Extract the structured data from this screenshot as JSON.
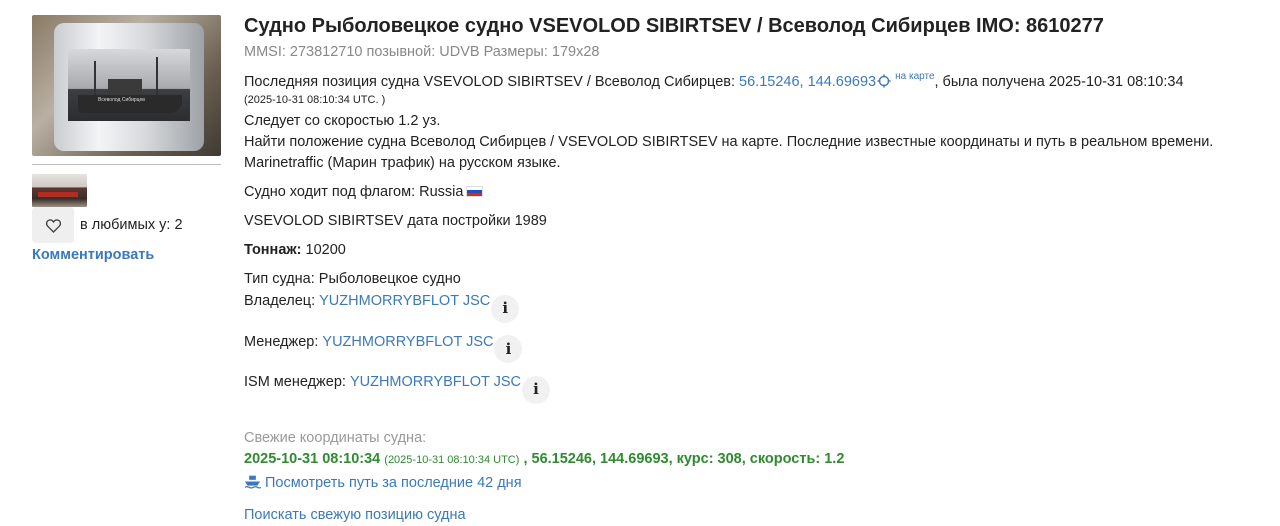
{
  "vessel": {
    "title": "Судно Рыболовецкое судно VSEVOLOD SIBIRTSEV / Всеволод Сибирцев IMO: 8610277",
    "sub_info": "MMSI: 273812710 позывной: UDVB Размеры: 179x28",
    "photo_caption": "Всеволод Сибирцев"
  },
  "position": {
    "prefix": "Последняя позиция судна VSEVOLOD SIBIRTSEV / Всеволод Сибирцев: ",
    "coords_link": "56.15246, 144.69693",
    "on_map_label": "на карте",
    "suffix": ", была получена 2025-10-31 08:10:34",
    "utc_note": "(2025-10-31 08:10:34 UTC. )"
  },
  "speed_line": "Следует со скоростью 1.2 уз.",
  "description_line1": "Найти положение судна Всеволод Сибирцев / VSEVOLOD SIBIRTSEV на карте. Последние известные координаты и путь в реальном времени.",
  "description_line2": "Marinetraffic (Марин трафик) на русском языке.",
  "flag": {
    "label": "Судно ходит под флагом: Russia"
  },
  "build_line": "VSEVOLOD SIBIRTSEV дата постройки 1989",
  "tonnage": {
    "label": "Тоннаж:",
    "value": " 10200"
  },
  "type_line": "Тип судна: Рыболовецкое судно",
  "owner": {
    "label": "Владелец: ",
    "value": "YUZHMORRYBFLOT JSC"
  },
  "manager": {
    "label": "Менеджер: ",
    "value": "YUZHMORRYBFLOT JSC"
  },
  "ism_manager": {
    "label": "ISM менеджер: ",
    "value": "YUZHMORRYBFLOT JSC"
  },
  "info_glyph": "i",
  "fresh": {
    "heading": "Свежие координаты судна:",
    "time": "2025-10-31 08:10:34",
    "utc": "(2025-10-31 08:10:34 UTC)",
    "rest": " , 56.15246, 144.69693, курс: 308, скорость: 1.2",
    "track_link": "Посмотреть путь за последние 42 дня",
    "search_link": "Поискать свежую позицию судна"
  },
  "sidebar": {
    "favorites_label": "в любимых у: 2",
    "comment_label": "Комментировать"
  },
  "icons": [
    "heart-icon",
    "crosshair-icon",
    "info-icon",
    "ship-icon",
    "russia-flag-icon"
  ],
  "colors": {
    "link": "#3a78c0",
    "green": "#2e8b2e",
    "muted": "#888888"
  }
}
